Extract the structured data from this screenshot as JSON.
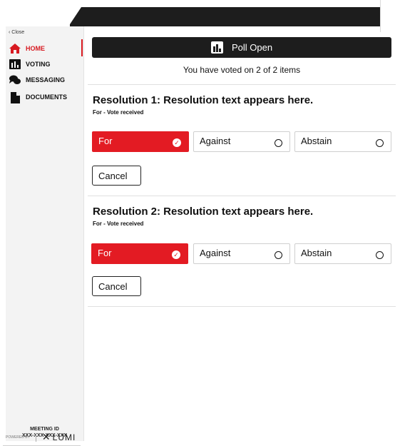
{
  "sidebar": {
    "close_label": "Close",
    "items": [
      {
        "label": "HOME",
        "icon": "home-icon"
      },
      {
        "label": "VOTING",
        "icon": "voting-icon"
      },
      {
        "label": "MESSAGING",
        "icon": "messaging-icon"
      },
      {
        "label": "DOCUMENTS",
        "icon": "documents-icon"
      }
    ],
    "meeting_id_label": "MEETING ID",
    "meeting_id": "XXX-XXX-XXX-XXX",
    "powered_by": "POWERED BY",
    "brand": "LUMI"
  },
  "poll": {
    "status": "Poll Open",
    "voted_text": "You have voted on 2 of 2 items"
  },
  "resolutions": [
    {
      "title": "Resolution 1: Resolution text appears here.",
      "status": "For - Vote received",
      "options": [
        "For",
        "Against",
        "Abstain"
      ],
      "selected": "For",
      "cancel_label": "Cancel"
    },
    {
      "title": "Resolution 2: Resolution text appears here.",
      "status": "For - Vote received",
      "options": [
        "For",
        "Against",
        "Abstain"
      ],
      "selected": "For",
      "cancel_label": "Cancel"
    }
  ],
  "colors": {
    "accent": "#e31b23",
    "dark": "#1d1d1d"
  }
}
